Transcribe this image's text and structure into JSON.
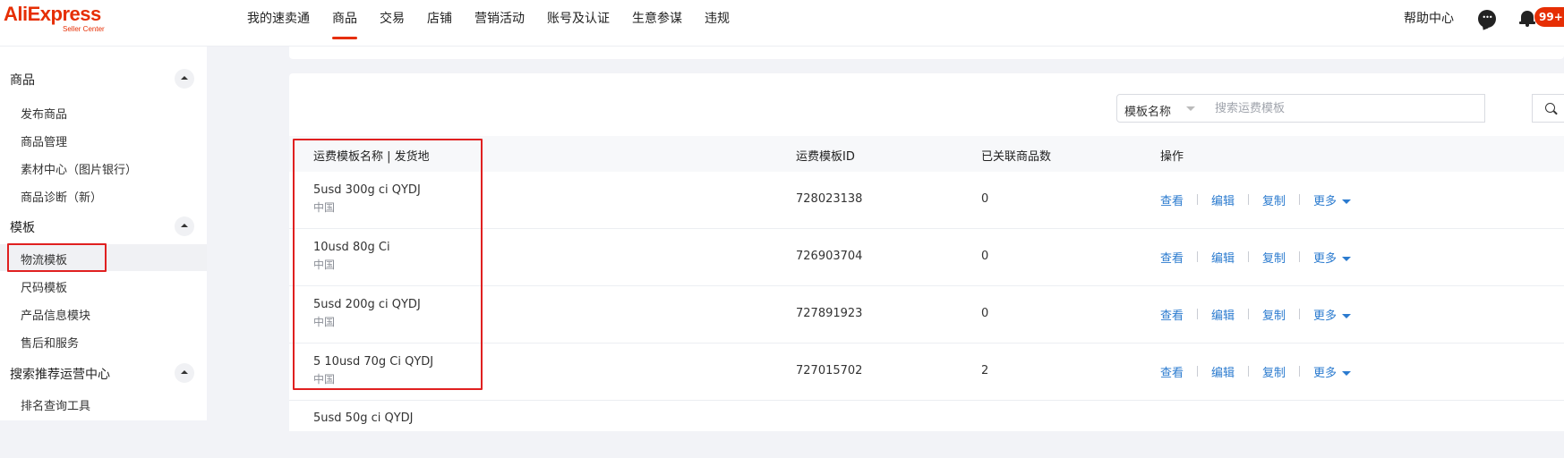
{
  "brand": {
    "logo_text": "AliExpress",
    "logo_sub": "Seller Center",
    "accent": "#e62e04"
  },
  "topnav": {
    "items": [
      {
        "label": "我的速卖通",
        "active": false
      },
      {
        "label": "商品",
        "active": true
      },
      {
        "label": "交易",
        "active": false
      },
      {
        "label": "店铺",
        "active": false
      },
      {
        "label": "营销活动",
        "active": false
      },
      {
        "label": "账号及认证",
        "active": false
      },
      {
        "label": "生意参谋",
        "active": false
      },
      {
        "label": "违规",
        "active": false
      }
    ],
    "help_label": "帮助中心",
    "chat_icon": "chat-icon",
    "bell_icon": "bell-icon",
    "notification_badge": "99+"
  },
  "sidebar": {
    "group_products": "商品",
    "product_items": [
      "发布商品",
      "商品管理",
      "素材中心（图片银行）",
      "商品诊断（新）"
    ],
    "group_templates": "模板",
    "template_items": [
      "物流模板",
      "尺码模板",
      "产品信息模块",
      "售后和服务"
    ],
    "selected_item": "物流模板",
    "group_search": "搜索推荐运营中心",
    "search_items": [
      "排名查询工具"
    ],
    "collapse_icon": "chevron-up-icon"
  },
  "search": {
    "select_value": "模板名称",
    "placeholder": "搜索运费模板",
    "value": "",
    "icon": "search-icon"
  },
  "table": {
    "headers": {
      "name": "运费模板名称 | 发货地",
      "id": "运费模板ID",
      "count": "已关联商品数",
      "ops": "操作"
    },
    "actions": {
      "view": "查看",
      "edit": "编辑",
      "copy": "复制",
      "more": "更多"
    },
    "rows": [
      {
        "name": "5usd 300g ci QYDJ",
        "origin": "中国",
        "id": "728023138",
        "count": "0"
      },
      {
        "name": "10usd 80g Ci",
        "origin": "中国",
        "id": "726903704",
        "count": "0"
      },
      {
        "name": "5usd 200g ci QYDJ",
        "origin": "中国",
        "id": "727891923",
        "count": "0"
      },
      {
        "name": "5 10usd 70g Ci QYDJ",
        "origin": "中国",
        "id": "727015702",
        "count": "2"
      },
      {
        "name": "5usd 50g ci QYDJ",
        "origin": "",
        "id": "",
        "count": ""
      }
    ]
  },
  "highlight_color": "#e02020",
  "link_color": "#2b7bcf"
}
